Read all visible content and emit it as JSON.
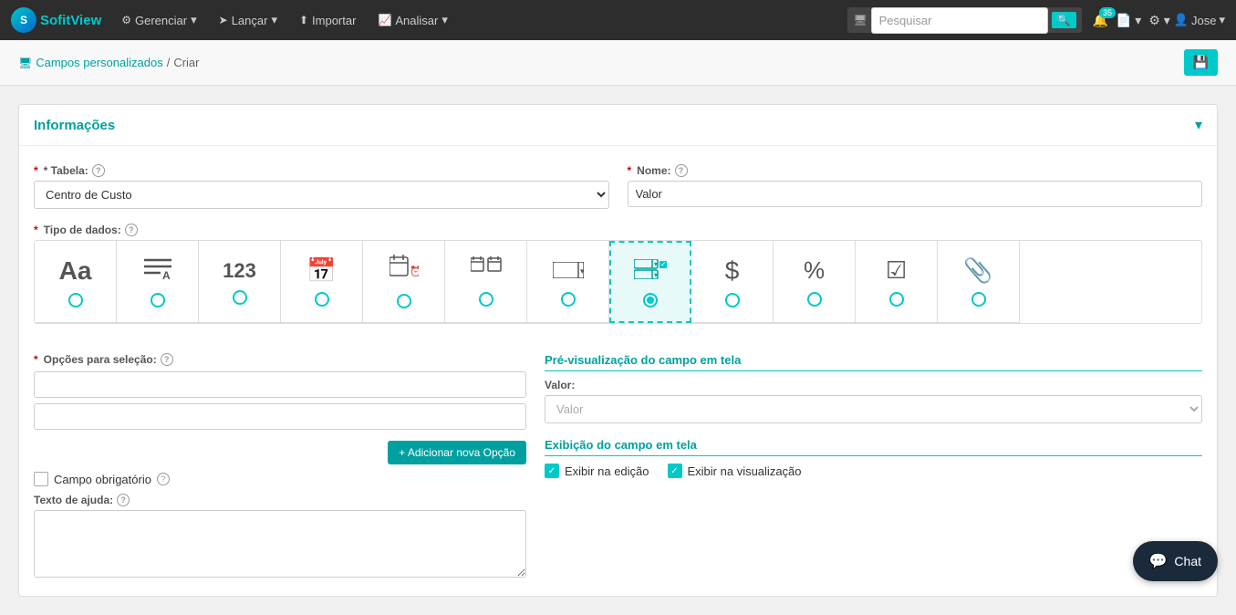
{
  "app": {
    "logo_text_1": "Sofit",
    "logo_text_2": "View"
  },
  "nav": {
    "gerenciar": "Gerenciar",
    "lancar": "Lançar",
    "importar": "Importar",
    "analisar": "Analisar",
    "search_placeholder": "Pesquisar",
    "notifications_count": "35",
    "user_name": "Jose"
  },
  "breadcrumb": {
    "link_text": "Campos personalizados",
    "separator": "/",
    "current": "Criar"
  },
  "card": {
    "title": "Informações"
  },
  "form": {
    "tabela_label": "* Tabela:",
    "tabela_value": "Centro de Custo",
    "nome_label": "* Nome:",
    "nome_value": "Valor",
    "tipo_dados_label": "* Tipo de dados:",
    "opcoes_label": "* Opções para seleção:",
    "add_option_btn": "+ Adicionar nova Opção",
    "mandatory_label": "Campo obrigatório",
    "help_text_label": "Texto de ajuda:"
  },
  "data_types": [
    {
      "icon": "Aa",
      "type": "text",
      "selected": false
    },
    {
      "icon": "≡A",
      "type": "textarea",
      "selected": false
    },
    {
      "icon": "123",
      "type": "number",
      "selected": false
    },
    {
      "icon": "📅",
      "type": "date",
      "selected": false
    },
    {
      "icon": "📅⏰",
      "type": "datetime",
      "selected": false
    },
    {
      "icon": "📅📅",
      "type": "daterange",
      "selected": false
    },
    {
      "icon": "▬",
      "type": "select",
      "selected": false
    },
    {
      "icon": "☑▬",
      "type": "multiselect",
      "selected": true
    },
    {
      "icon": "$",
      "type": "currency",
      "selected": false
    },
    {
      "icon": "%",
      "type": "percent",
      "selected": false
    },
    {
      "icon": "☑",
      "type": "checkbox",
      "selected": false
    },
    {
      "icon": "📎",
      "type": "attachment",
      "selected": false
    }
  ],
  "preview": {
    "section_title": "Pré-visualização do campo em tela",
    "field_label": "Valor:",
    "field_placeholder": "Valor"
  },
  "display": {
    "section_title": "Exibição do campo em tela",
    "show_edit_label": "Exibir na edição",
    "show_view_label": "Exibir na visualização",
    "show_edit_checked": true,
    "show_view_checked": true
  },
  "chat": {
    "label": "Chat",
    "icon": "💬"
  }
}
